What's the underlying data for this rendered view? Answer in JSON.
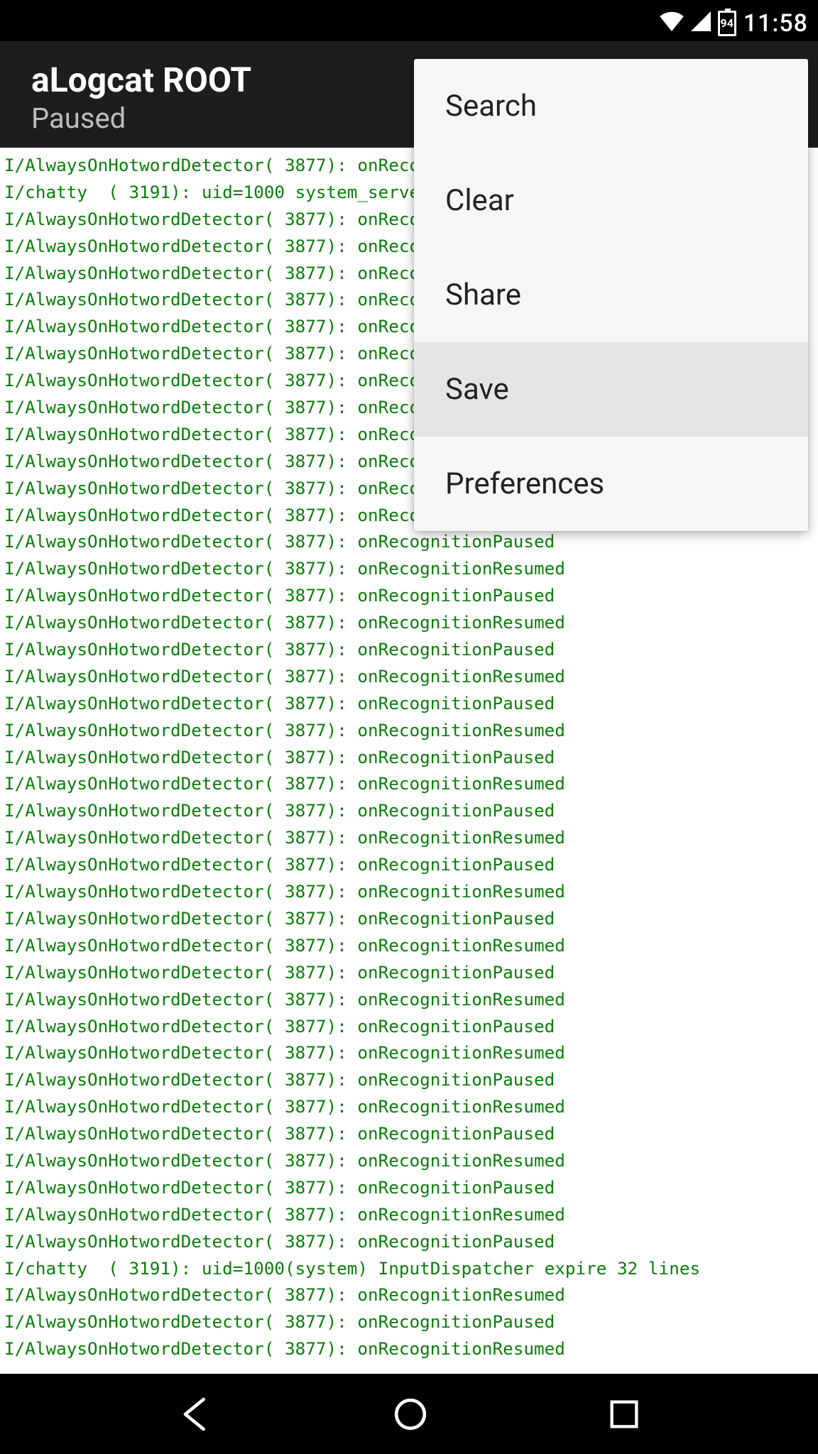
{
  "status": {
    "battery_pct": "94",
    "time": "11:58"
  },
  "appbar": {
    "title": "aLogcat ROOT",
    "subtitle": "Paused"
  },
  "popup": {
    "items": [
      {
        "label": "Search",
        "highlighted": false
      },
      {
        "label": "Clear",
        "highlighted": false
      },
      {
        "label": "Share",
        "highlighted": false
      },
      {
        "label": "Save",
        "highlighted": true
      },
      {
        "label": "Preferences",
        "highlighted": false
      }
    ]
  },
  "log": {
    "lines": [
      "I/AlwaysOnHotwordDetector( 3877): onRecognitionPaused",
      "I/chatty  ( 3191): uid=1000 system_server expire 1 line",
      "I/AlwaysOnHotwordDetector( 3877): onRecognitionResumed",
      "I/AlwaysOnHotwordDetector( 3877): onRecognitionPaused",
      "I/AlwaysOnHotwordDetector( 3877): onRecognitionResumed",
      "I/AlwaysOnHotwordDetector( 3877): onRecognitionPaused",
      "I/AlwaysOnHotwordDetector( 3877): onRecognitionResumed",
      "I/AlwaysOnHotwordDetector( 3877): onRecognitionPaused",
      "I/AlwaysOnHotwordDetector( 3877): onRecognitionResumed",
      "I/AlwaysOnHotwordDetector( 3877): onRecognitionPaused",
      "I/AlwaysOnHotwordDetector( 3877): onRecognitionResumed",
      "I/AlwaysOnHotwordDetector( 3877): onRecognitionPaused",
      "I/AlwaysOnHotwordDetector( 3877): onRecognitionResumed",
      "I/AlwaysOnHotwordDetector( 3877): onRecognitionPaused",
      "I/AlwaysOnHotwordDetector( 3877): onRecognitionPaused",
      "I/AlwaysOnHotwordDetector( 3877): onRecognitionResumed",
      "I/AlwaysOnHotwordDetector( 3877): onRecognitionPaused",
      "I/AlwaysOnHotwordDetector( 3877): onRecognitionResumed",
      "I/AlwaysOnHotwordDetector( 3877): onRecognitionPaused",
      "I/AlwaysOnHotwordDetector( 3877): onRecognitionResumed",
      "I/AlwaysOnHotwordDetector( 3877): onRecognitionPaused",
      "I/AlwaysOnHotwordDetector( 3877): onRecognitionResumed",
      "I/AlwaysOnHotwordDetector( 3877): onRecognitionPaused",
      "I/AlwaysOnHotwordDetector( 3877): onRecognitionResumed",
      "I/AlwaysOnHotwordDetector( 3877): onRecognitionPaused",
      "I/AlwaysOnHotwordDetector( 3877): onRecognitionResumed",
      "I/AlwaysOnHotwordDetector( 3877): onRecognitionPaused",
      "I/AlwaysOnHotwordDetector( 3877): onRecognitionResumed",
      "I/AlwaysOnHotwordDetector( 3877): onRecognitionPaused",
      "I/AlwaysOnHotwordDetector( 3877): onRecognitionResumed",
      "I/AlwaysOnHotwordDetector( 3877): onRecognitionPaused",
      "I/AlwaysOnHotwordDetector( 3877): onRecognitionResumed",
      "I/AlwaysOnHotwordDetector( 3877): onRecognitionPaused",
      "I/AlwaysOnHotwordDetector( 3877): onRecognitionResumed",
      "I/AlwaysOnHotwordDetector( 3877): onRecognitionPaused",
      "I/AlwaysOnHotwordDetector( 3877): onRecognitionResumed",
      "I/AlwaysOnHotwordDetector( 3877): onRecognitionPaused",
      "I/AlwaysOnHotwordDetector( 3877): onRecognitionResumed",
      "I/AlwaysOnHotwordDetector( 3877): onRecognitionPaused",
      "I/AlwaysOnHotwordDetector( 3877): onRecognitionResumed",
      "I/AlwaysOnHotwordDetector( 3877): onRecognitionPaused",
      "I/chatty  ( 3191): uid=1000(system) InputDispatcher expire 32 lines",
      "I/AlwaysOnHotwordDetector( 3877): onRecognitionResumed",
      "I/AlwaysOnHotwordDetector( 3877): onRecognitionPaused",
      "I/AlwaysOnHotwordDetector( 3877): onRecognitionResumed"
    ]
  }
}
